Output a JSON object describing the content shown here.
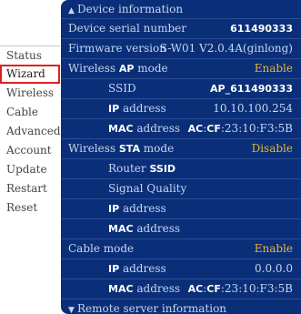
{
  "sidebar": {
    "items": [
      "Status",
      "Wizard",
      "Wireless",
      "Cable",
      "Advanced",
      "Account",
      "Update",
      "Restart",
      "Reset"
    ],
    "active": "Wizard"
  },
  "device_info": {
    "header": "Device information",
    "serial_label": "Device serial number",
    "serial_value": "611490333",
    "firmware_label": "Firmware version",
    "firmware_value": "S-W01 V2.0.4A(ginlong)",
    "ap_mode_prefix": "Wireless ",
    "ap_mode_bold": "AP",
    "ap_mode_suffix": " mode",
    "ap_mode_value": "Enable",
    "ssid_label": "SSID",
    "ssid_value": "AP_611490333",
    "ip_bold": "IP",
    "ip_suffix": " address",
    "ap_ip_value": "10.10.100.254",
    "mac_bold": "MAC",
    "mac_suffix": " address",
    "ap_mac_bold1": "AC",
    "ap_mac_sep": ":",
    "ap_mac_bold2": "CF",
    "ap_mac_rest": ":23:10:F3:5B",
    "sta_mode_prefix": "Wireless ",
    "sta_mode_bold": "STA",
    "sta_mode_suffix": " mode",
    "sta_mode_value": "Disable",
    "router_ssid_prefix": "Router ",
    "router_ssid_bold": "SSID",
    "signal_quality_label": "Signal Quality",
    "cable_mode_label": "Cable mode",
    "cable_mode_value": "Enable",
    "cable_ip_value": "0.0.0.0",
    "cable_mac_bold1": "AC",
    "cable_mac_sep": ":",
    "cable_mac_bold2": "CF",
    "cable_mac_rest": ":23:10:F3:5B"
  },
  "remote_server": {
    "header": "Remote server information"
  },
  "colors": {
    "panel": "#0a2f78",
    "accent_value": "#e6b43c",
    "active_outline": "#e02020"
  }
}
